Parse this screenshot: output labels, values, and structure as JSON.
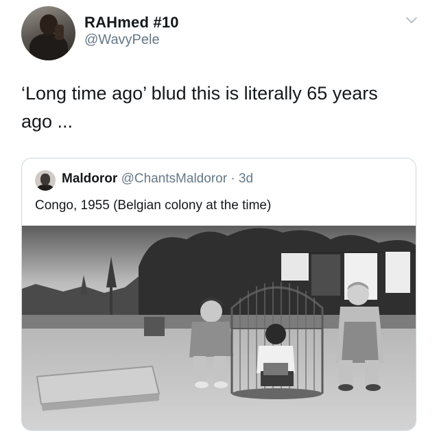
{
  "tweet": {
    "display_name": "RAHmed #10",
    "handle": "@WavyPele",
    "text": "‘Long time ago’ blud this is literally 65 years ago ...",
    "icons": {
      "avatar": "user-avatar",
      "menu": "chevron-down-icon"
    }
  },
  "quoted_tweet": {
    "display_name": "Maldoror",
    "handle": "@ChantsMaldoror",
    "separator": "·",
    "time": "3d",
    "text": "Congo, 1955 (Belgian colony at the time)",
    "media": {
      "type": "photo",
      "style": "black-and-white"
    }
  }
}
